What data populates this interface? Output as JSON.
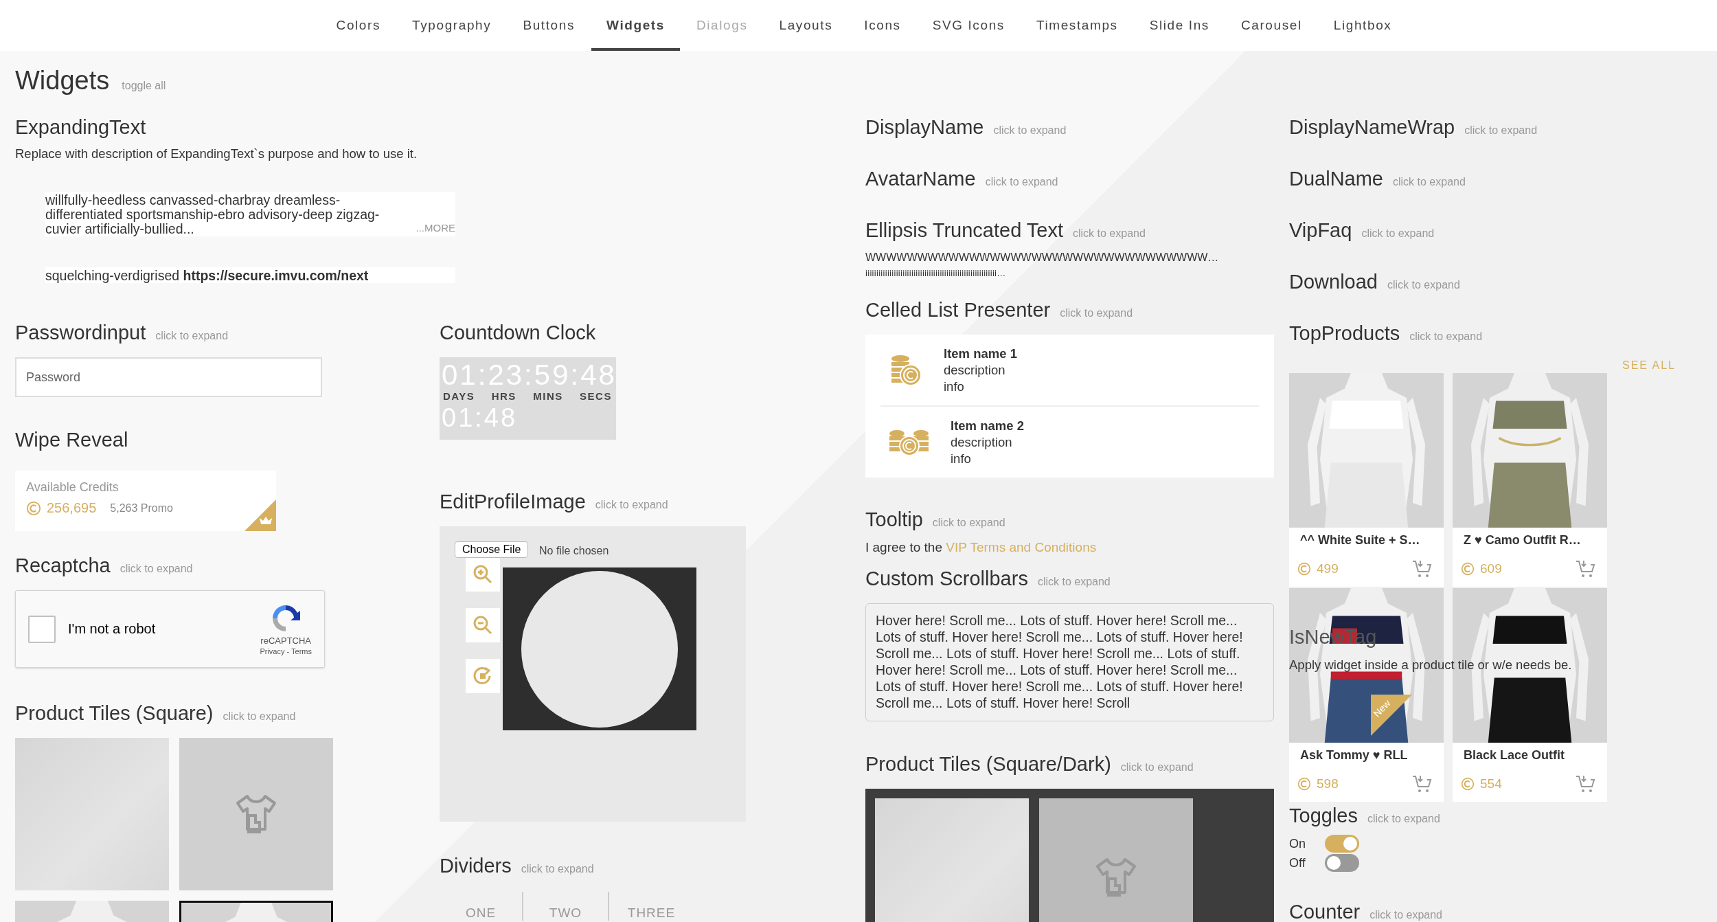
{
  "nav": [
    {
      "label": "Colors",
      "selected": false,
      "disabled": false
    },
    {
      "label": "Typography",
      "selected": false,
      "disabled": false
    },
    {
      "label": "Buttons",
      "selected": false,
      "disabled": false
    },
    {
      "label": "Widgets",
      "selected": true,
      "disabled": false
    },
    {
      "label": "Dialogs",
      "selected": false,
      "disabled": true
    },
    {
      "label": "Layouts",
      "selected": false,
      "disabled": false
    },
    {
      "label": "Icons",
      "selected": false,
      "disabled": false
    },
    {
      "label": "SVG Icons",
      "selected": false,
      "disabled": false
    },
    {
      "label": "Timestamps",
      "selected": false,
      "disabled": false
    },
    {
      "label": "Slide Ins",
      "selected": false,
      "disabled": false
    },
    {
      "label": "Carousel",
      "selected": false,
      "disabled": false
    },
    {
      "label": "Lightbox",
      "selected": false,
      "disabled": false
    }
  ],
  "page": {
    "title": "Widgets",
    "toggle_all": "toggle all"
  },
  "expanding_text": {
    "heading": "ExpandingText",
    "description": "Replace with description of ExpandingText`s purpose and how to use it.",
    "items": [
      {
        "text": "willfully-heedless canvassed-charbray dreamless-differentiated sportsmanship-ebro advisory-deep zigzag-cuvier artificially-bullied...",
        "more": "...MORE"
      },
      {
        "text": "squelching-verdigrised **https://secure.imvu.com/next**"
      }
    ]
  },
  "password_input": {
    "heading": "Passwordinput",
    "hint": "click to expand",
    "placeholder": "Password"
  },
  "wipe_reveal": {
    "heading": "Wipe Reveal",
    "label": "Available Credits",
    "credits": "256,695",
    "promo": "5,263 Promo"
  },
  "recaptcha": {
    "heading": "Recaptcha",
    "hint": "click to expand",
    "label": "I'm not a robot",
    "checked": false,
    "brand": "reCAPTCHA",
    "links": "Privacy - Terms"
  },
  "product_tiles_square": {
    "heading": "Product Tiles (Square)",
    "hint": "click to expand",
    "tiles": [
      {
        "kind": "blank",
        "selected": false
      },
      {
        "kind": "placeholder",
        "selected": false
      },
      {
        "kind": "picture",
        "selected": false
      },
      {
        "kind": "picture",
        "selected": true
      }
    ]
  },
  "countdown": {
    "heading": "Countdown Clock",
    "digits": "01:23:59:48",
    "units": [
      "DAYS",
      "HRS",
      "MINS",
      "SECS"
    ],
    "short": "01:48"
  },
  "edit_profile_image": {
    "heading": "EditProfileImage",
    "hint": "click to expand",
    "choose_file": "Choose File",
    "file_status": "No file chosen"
  },
  "dividers": {
    "heading": "Dividers",
    "hint": "click to expand",
    "items": [
      "ONE",
      "TWO",
      "THREE"
    ]
  },
  "display_name": {
    "heading": "DisplayName",
    "hint": "click to expand"
  },
  "avatar_name": {
    "heading": "AvatarName",
    "hint": "click to expand"
  },
  "ellipsis_truncated_text": {
    "heading": "Ellipsis Truncated Text",
    "hint": "click to expand",
    "lines": [
      "WWWWWWWWWWWWWWWWWWWWWWWWWWWWWWWWW…",
      "iiiiiiiiiiiiiiiiiiiiiiiiiiiiiiiiiiiiiiiiiiiiiiiiiiiiiiiiiiii…"
    ]
  },
  "celled_list_presenter": {
    "heading": "Celled List Presenter",
    "hint": "click to expand",
    "items": [
      {
        "name": "Item name 1",
        "description": "description",
        "info": "info",
        "kind": "coin-stack"
      },
      {
        "name": "Item name 2",
        "description": "description",
        "info": "info",
        "kind": "coin-stacks"
      }
    ]
  },
  "tooltip": {
    "heading": "Tooltip",
    "hint": "click to expand",
    "text": "I agree to the",
    "link": "VIP Terms and Conditions"
  },
  "custom_scrollbars": {
    "heading": "Custom Scrollbars",
    "hint": "click to expand",
    "text": "Hover here! Scroll me... Lots of stuff. Hover here! Scroll me... Lots of stuff. Hover here! Scroll me... Lots of stuff. Hover here! Scroll me... Lots of stuff. Hover here! Scroll me... Lots of stuff. Hover here! Scroll me... Lots of stuff. Hover here! Scroll me... Lots of stuff. Hover here! Scroll me... Lots of stuff. Hover here! Scroll me... Lots of stuff. Hover here! Scroll"
  },
  "product_tiles_dark": {
    "heading": "Product Tiles (Square/Dark)",
    "hint": "click to expand",
    "tiles": [
      {
        "kind": "blank"
      },
      {
        "kind": "placeholder"
      }
    ]
  },
  "display_name_wrap": {
    "heading": "DisplayNameWrap",
    "hint": "click to expand"
  },
  "dual_name": {
    "heading": "DualName",
    "hint": "click to expand"
  },
  "vip_faq": {
    "heading": "VipFaq",
    "hint": "click to expand"
  },
  "download": {
    "heading": "Download",
    "hint": "click to expand"
  },
  "top_products": {
    "heading": "TopProducts",
    "hint": "click to expand",
    "see_all": "SEE ALL",
    "new_label": "New",
    "products": [
      {
        "name": "^^ White Suite + S…",
        "price": "499",
        "new": false,
        "kind": "white"
      },
      {
        "name": "Z ♥ Camo Outfit R…",
        "price": "609",
        "new": false,
        "kind": "camo"
      },
      {
        "name": "Ask Tommy ♥ RLL",
        "price": "598",
        "new": true,
        "kind": "denim"
      },
      {
        "name": "Black Lace Outfit",
        "price": "554",
        "new": false,
        "kind": "black"
      }
    ]
  },
  "is_new_tag": {
    "heading": "IsNewTag",
    "text": "Apply widget inside a product tile or w/e needs be."
  },
  "toggles": {
    "heading": "Toggles",
    "hint": "click to expand",
    "items": [
      {
        "label": "On",
        "on": true
      },
      {
        "label": "Off",
        "on": false
      }
    ]
  },
  "counter": {
    "heading": "Counter",
    "hint": "click to expand"
  }
}
